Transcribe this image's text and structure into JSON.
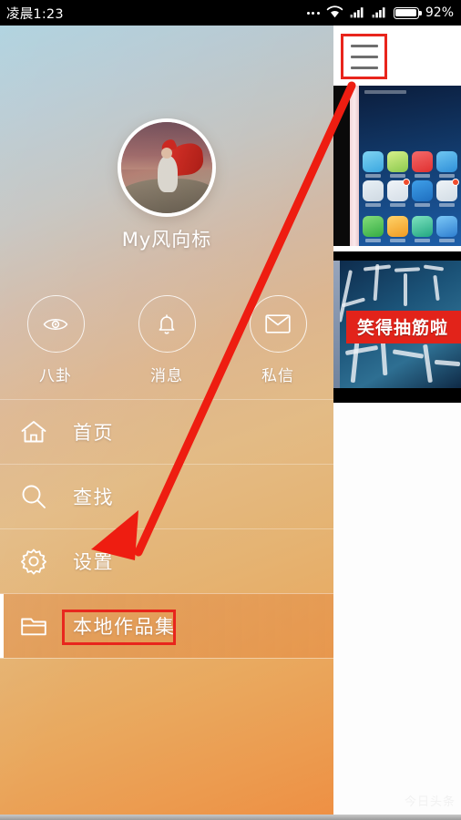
{
  "status_bar": {
    "clock": "凌晨1:23",
    "battery_percent": "92%",
    "icons": [
      "more-dots-icon",
      "wifi-icon",
      "signal-icon",
      "signal-icon",
      "battery-icon"
    ]
  },
  "drawer": {
    "profile": {
      "username": "My风向标",
      "avatar_name": "user-avatar"
    },
    "quick_actions": [
      {
        "label": "八卦",
        "icon": "eye-icon"
      },
      {
        "label": "消息",
        "icon": "bell-icon"
      },
      {
        "label": "私信",
        "icon": "envelope-icon"
      }
    ],
    "menu": [
      {
        "label": "首页",
        "icon": "home-icon",
        "selected": false
      },
      {
        "label": "查找",
        "icon": "search-icon",
        "selected": false
      },
      {
        "label": "设置",
        "icon": "gear-icon",
        "selected": false
      },
      {
        "label": "本地作品集",
        "icon": "folder-icon",
        "selected": true
      }
    ]
  },
  "content_panel": {
    "menu_button_icon": "hamburger-menu-icon",
    "thumbnails": [
      {
        "name": "phone-homescreen-thumbnail",
        "caption": ""
      },
      {
        "name": "video-thumbnail",
        "caption": "笑得抽筋啦"
      }
    ],
    "watermark": "今日头条"
  },
  "annotations": {
    "highlight_boxes": [
      "hamburger-menu-icon",
      "本地作品集"
    ],
    "arrow": "points from hamburger menu icon to 本地作品集 menu item",
    "accent_color": "#e8251c"
  }
}
